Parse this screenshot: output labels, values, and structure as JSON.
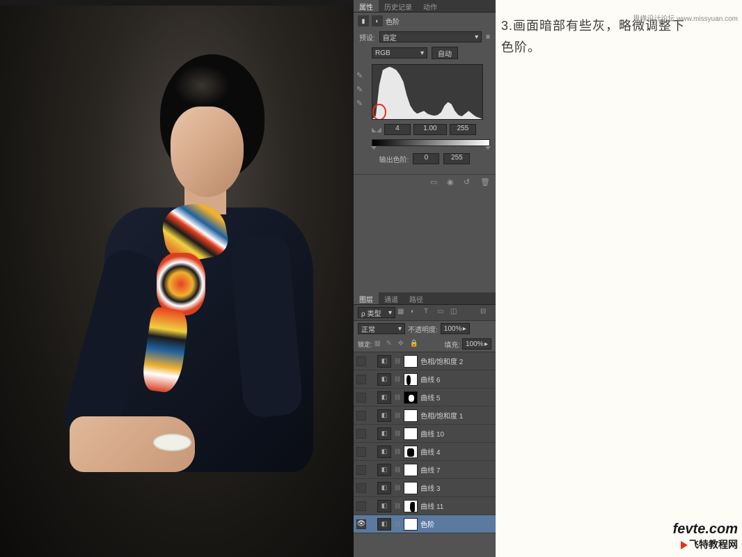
{
  "instruction": {
    "line1": "3.画面暗部有些灰，略微调整下",
    "line2": "色阶。"
  },
  "watermarks": {
    "top": "思缘设计论坛 www.missyuan.com",
    "bottom_domain": "fevte.com",
    "bottom_cn": "飞特教程网"
  },
  "properties_panel": {
    "tabs": [
      "属性",
      "历史记录",
      "动作"
    ],
    "active_tab": 0,
    "adjustment_type": "色阶",
    "preset_label": "预设:",
    "preset_value": "自定",
    "channel": "RGB",
    "auto_btn": "自动",
    "input_levels": {
      "shadow": "4",
      "mid": "1.00",
      "highlight": "255"
    },
    "output_label": "输出色阶:",
    "output_levels": {
      "black": "0",
      "white": "255"
    }
  },
  "layers_panel": {
    "tabs": [
      "图层",
      "通道",
      "路径"
    ],
    "active_tab": 0,
    "filter_label": "ρ 类型",
    "blend_mode": "正常",
    "opacity_label": "不透明度:",
    "opacity_value": "100%",
    "lock_label": "锁定:",
    "fill_label": "填充:",
    "fill_value": "100%",
    "layers": [
      {
        "name": "色相/饱和度 2",
        "mask": "white",
        "visible": false
      },
      {
        "name": "曲线 6",
        "mask": "shape1",
        "visible": false
      },
      {
        "name": "曲线 5",
        "mask": "shape2",
        "visible": false
      },
      {
        "name": "色相/饱和度 1",
        "mask": "white",
        "visible": false
      },
      {
        "name": "曲线 10",
        "mask": "white",
        "visible": false
      },
      {
        "name": "曲线 4",
        "mask": "shape3",
        "visible": false
      },
      {
        "name": "曲线 7",
        "mask": "white",
        "visible": false
      },
      {
        "name": "曲线 3",
        "mask": "white",
        "visible": false
      },
      {
        "name": "曲线 11",
        "mask": "shape4",
        "visible": false
      },
      {
        "name": "色阶",
        "mask": "white",
        "visible": true,
        "selected": true
      }
    ]
  }
}
